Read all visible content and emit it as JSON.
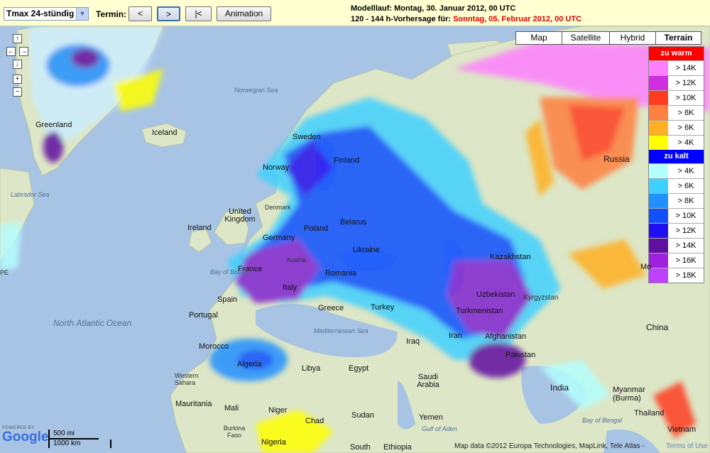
{
  "toolbar": {
    "product_select": "Tmax 24-stündig",
    "termin_label": "Termin:",
    "prev_button": "<",
    "next_button": ">",
    "first_button": "|<",
    "animation_button": "Animation",
    "model_run_line": "Modelllauf: Montag, 30. Januar 2012, 00 UTC",
    "forecast_prefix": "120 - 144 h-Vorhersage für: ",
    "forecast_date": "Sonntag, 05. Februar 2012, 00 UTC"
  },
  "map_types": [
    "Map",
    "Satellite",
    "Hybrid",
    "Terrain"
  ],
  "active_map_type": "Terrain",
  "nav_icons": [
    "pan-up-icon",
    "pan-left-icon",
    "pan-right-icon",
    "pan-down-icon",
    "zoom-in-icon",
    "zoom-out-icon"
  ],
  "legend": {
    "warm_title": "zu warm",
    "warm_color": "#ff0000",
    "warm": [
      {
        "label": "> 14K",
        "color": "#ff80ff"
      },
      {
        "label": "> 12K",
        "color": "#d02ee0"
      },
      {
        "label": "> 10K",
        "color": "#ff3c20"
      },
      {
        "label": "> 8K",
        "color": "#ff8040"
      },
      {
        "label": "> 6K",
        "color": "#ffb020"
      },
      {
        "label": "> 4K",
        "color": "#ffff00"
      }
    ],
    "cold_title": "zu kalt",
    "cold_color": "#0000ff",
    "cold": [
      {
        "label": "> 4K",
        "color": "#b4ffff"
      },
      {
        "label": "> 6K",
        "color": "#40d0ff"
      },
      {
        "label": "> 8K",
        "color": "#2090ff"
      },
      {
        "label": "> 10K",
        "color": "#1050ff"
      },
      {
        "label": "> 12K",
        "color": "#2010f0"
      },
      {
        "label": "> 14K",
        "color": "#6010a0"
      },
      {
        "label": "> 16K",
        "color": "#a020e0"
      },
      {
        "label": "> 18K",
        "color": "#c040ff"
      }
    ]
  },
  "map_labels": {
    "greenland": "Greenland",
    "iceland": "Iceland",
    "norwegian_sea": "Norwegian Sea",
    "labrador_sea": "Labrador Sea",
    "sweden": "Sweden",
    "norway": "Norway",
    "finland": "Finland",
    "russia": "Russia",
    "denmark": "Denmark",
    "united_kingdom": "United Kingdom",
    "ireland": "Ireland",
    "poland": "Poland",
    "belarus": "Belarus",
    "germany": "Germany",
    "ukraine": "Ukraine",
    "kazakhstan": "Kazakhstan",
    "france": "France",
    "austria": "Austria",
    "romania": "Romania",
    "bay_of_biscay": "Bay of Biscay",
    "italy": "Italy",
    "spain": "Spain",
    "portugal": "Portugal",
    "greece": "Greece",
    "turkey": "Turkey",
    "uzbekistan": "Uzbekistan",
    "kyrgyzstan": "Kyrgyzstan",
    "turkmenistan": "Turkmenistan",
    "north_atlantic_ocean": "North Atlantic Ocean",
    "mediterranean_sea": "Mediterranean Sea",
    "morocco": "Morocco",
    "iraq": "Iraq",
    "iran": "Iran",
    "afghanistan": "Afghanistan",
    "pakistan": "Pakistan",
    "china": "China",
    "algeria": "Algeria",
    "libya": "Libya",
    "egypt": "Egypt",
    "saudi_arabia": "Saudi Arabia",
    "india": "India",
    "western_sahara": "Western Sahara",
    "mauritania": "Mauritania",
    "mali": "Mali",
    "niger": "Niger",
    "chad": "Chad",
    "sudan": "Sudan",
    "yemen": "Yemen",
    "gulf_of_aden": "Gulf of Aden",
    "burkina_faso": "Burkina Faso",
    "nigeria": "Nigeria",
    "ethiopia": "Ethiopia",
    "south": "South",
    "myanmar": "Myanmar (Burma)",
    "thailand": "Thailand",
    "vietnam": "Vietnam",
    "bay_of_bengal": "Bay of Bengal",
    "mo": "Mo",
    "pe": "PE"
  },
  "scale": {
    "miles": "500 mi",
    "km": "1000 km"
  },
  "logo": {
    "powered_by": "POWERED BY",
    "google": "Google"
  },
  "copyright": "Map data ©2012 Europa Technologies, MapLink, Tele Atlas -",
  "terms_link": "Terms of Use"
}
